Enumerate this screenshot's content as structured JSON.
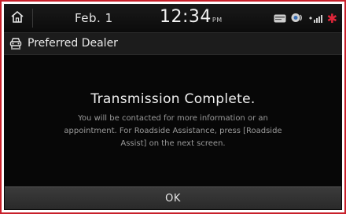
{
  "status_bar": {
    "date": "Feb.  1",
    "time": "12:34",
    "ampm": "PM",
    "icons": [
      "home-icon",
      "card-icon",
      "sound-icon",
      "signal-icon",
      "bluetooth-star-icon"
    ]
  },
  "header": {
    "title": "Preferred Dealer",
    "icon": "car-dealer-icon"
  },
  "message": {
    "title": "Transmission Complete.",
    "body": "You will be contacted for more information or an appointment. For Roadside Assistance, press [Roadside Assist] on the next screen."
  },
  "buttons": {
    "ok_label": "OK"
  },
  "colors": {
    "frame_border": "#c8202a",
    "screen_bg": "#070707",
    "accent_red": "#e0263a"
  }
}
